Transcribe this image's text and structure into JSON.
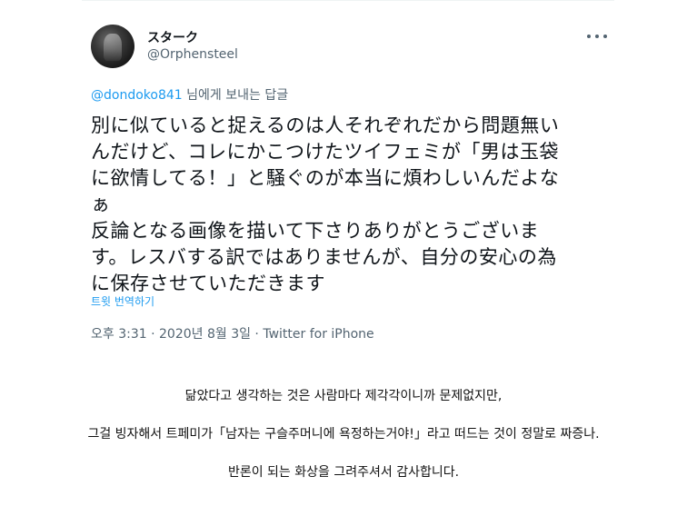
{
  "tweet": {
    "author": {
      "display_name": "スターク",
      "handle": "@Orphensteel"
    },
    "more_icon": "more-horizontal-icon",
    "reply": {
      "mention": "@dondoko841",
      "suffix": " 님에게 보내는 답글"
    },
    "text_lines": [
      "別に似ていると捉えるのは人それぞれだから問題無い",
      "んだけど、コレにかこつけたツイフェミが「男は玉袋",
      "に欲情してる！」と騒ぐのが本当に煩わしいんだよな",
      "ぁ",
      "反論となる画像を描いて下さりありがとうございま",
      "す。レスバする訳ではありませんが、自分の安心の為",
      "に保存させていただきます"
    ],
    "translate_label": "트윗 번역하기",
    "timestamp": "오후 3:31 · 2020년 8월 3일",
    "separator": " · ",
    "source": "Twitter for iPhone"
  },
  "translation": {
    "line1": "닮았다고 생각하는 것은 사람마다 제각각이니까 문제없지만,",
    "line2": "그걸 빙자해서 트페미가「남자는 구슬주머니에 욕정하는거야!」라고 떠드는 것이 정말로 짜증나.",
    "line3": "반론이 되는 화상을 그려주셔서 감사합니다."
  }
}
